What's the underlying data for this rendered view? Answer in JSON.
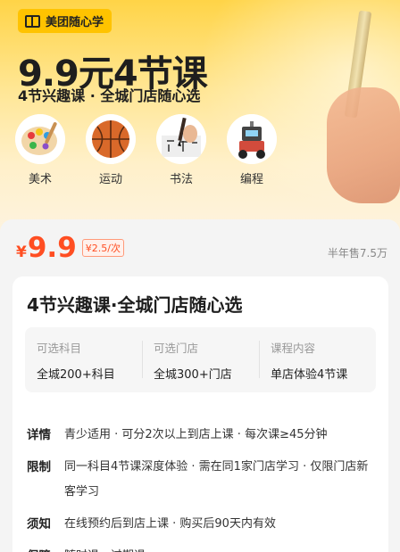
{
  "brand": {
    "name": "美团随心学",
    "icon": "book-icon"
  },
  "hero": {
    "title": "9.9元4节课",
    "subtitle": "4节兴趣课 · 全城门店随心选"
  },
  "categories": [
    {
      "label": "美术",
      "icon": "palette-icon"
    },
    {
      "label": "运动",
      "icon": "basketball-icon"
    },
    {
      "label": "书法",
      "icon": "calligraphy-brush-icon"
    },
    {
      "label": "编程",
      "icon": "robot-icon"
    }
  ],
  "price": {
    "currency": "¥",
    "value": "9.9",
    "unit_price": "¥2.5/次",
    "sold": "半年售7.5万"
  },
  "course": {
    "title": "4节兴趣课·全城门店随心选",
    "info": [
      {
        "label": "可选科目",
        "value": "全城200+科目"
      },
      {
        "label": "可选门店",
        "value": "全城300+门店"
      },
      {
        "label": "课程内容",
        "value": "单店体验4节课"
      }
    ],
    "details": [
      {
        "key": "详情",
        "value": "青少适用 · 可分2次以上到店上课 · 每次课≥45分钟"
      },
      {
        "key": "限制",
        "value": "同一科目4节课深度体验 · 需在同1家门店学习 · 仅限门店新客学习"
      },
      {
        "key": "须知",
        "value": "在线预约后到店上课 · 购买后90天内有效"
      },
      {
        "key": "保障",
        "value": "随时退、过期退"
      }
    ]
  },
  "colors": {
    "accent": "#ff4e22",
    "brand_yellow": "#ffc300"
  }
}
